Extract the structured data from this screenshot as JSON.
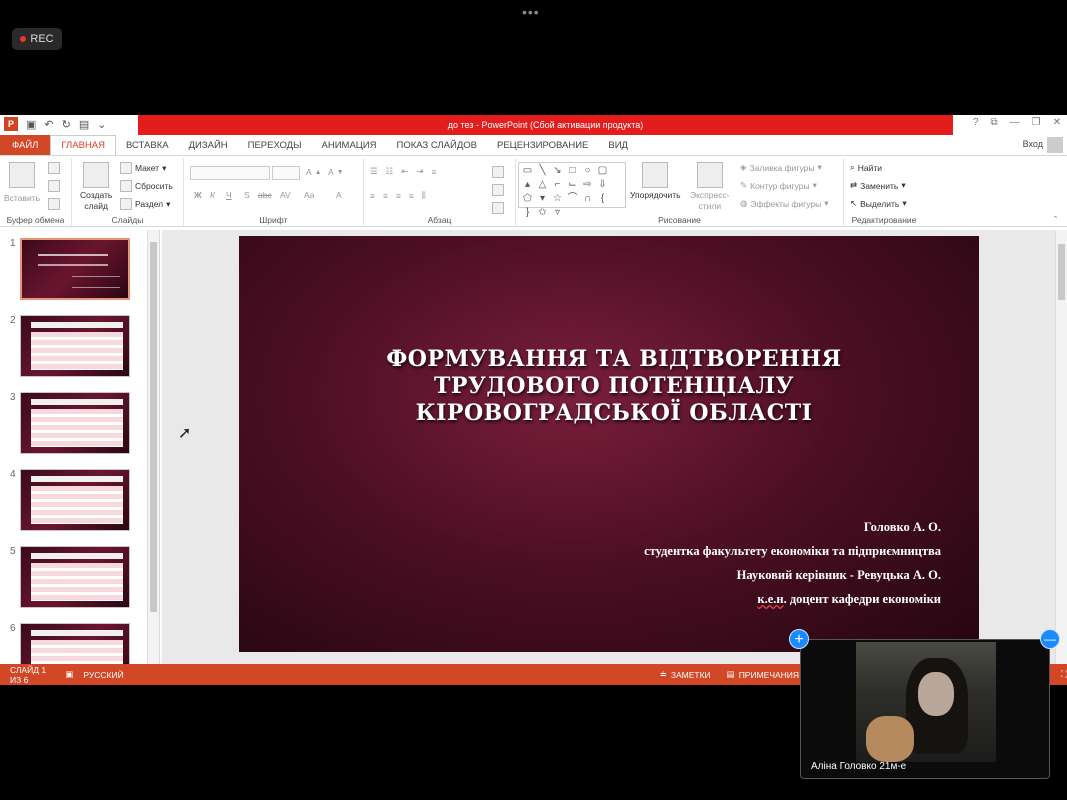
{
  "screen": {
    "dots": "•••",
    "rec_label": "REC"
  },
  "titlebar": {
    "title": "до тез -  PowerPoint (Сбой активации продукта)",
    "logo": "P",
    "controls": [
      "?",
      "⧉",
      "—",
      "❐",
      "✕"
    ]
  },
  "tabs": [
    "ФАЙЛ",
    "ГЛАВНАЯ",
    "ВСТАВКА",
    "ДИЗАЙН",
    "ПЕРЕХОДЫ",
    "АНИМАЦИЯ",
    "ПОКАЗ СЛАЙДОВ",
    "РЕЦЕНЗИРОВАНИЕ",
    "ВИД"
  ],
  "active_tab": "ГЛАВНАЯ",
  "signin": "Вход",
  "ribbon": {
    "clipboard": {
      "paste": "Вставить",
      "label": "Буфер обмена"
    },
    "slides": {
      "new_slide_1": "Создать",
      "new_slide_2": "слайд",
      "layout": "Макет",
      "reset": "Сбросить",
      "section": "Раздел",
      "label": "Слайды"
    },
    "font": {
      "label": "Шрифт",
      "bold": "Ж",
      "italic": "К",
      "underline": "Ч",
      "strike": "S",
      "abc": "abc",
      "spacing": "AV",
      "case": "Aa",
      "color": "A"
    },
    "paragraph": {
      "label": "Абзац"
    },
    "drawing": {
      "arrange_1": "Упорядочить",
      "styles_1": "Экспресс-",
      "styles_2": "стили",
      "fill": "Заливка фигуры",
      "outline": "Контур фигуры",
      "effects": "Эффекты фигуры",
      "label": "Рисование"
    },
    "editing": {
      "find": "Найти",
      "replace": "Заменить",
      "select": "Выделить",
      "label": "Редактирование"
    }
  },
  "thumbnails": [
    {
      "num": "1",
      "kind": "title",
      "selected": true
    },
    {
      "num": "2",
      "kind": "table",
      "selected": false
    },
    {
      "num": "3",
      "kind": "table",
      "selected": false
    },
    {
      "num": "4",
      "kind": "table",
      "selected": false
    },
    {
      "num": "5",
      "kind": "table",
      "selected": false
    },
    {
      "num": "6",
      "kind": "table",
      "selected": false
    }
  ],
  "slide": {
    "title_1": "ФОРМУВАННЯ ТА ВІДТВОРЕННЯ",
    "title_2": "ТРУДОВОГО ПОТЕНЦІАЛУ",
    "title_3": "КІРОВОГРАДСЬКОЇ ОБЛАСТІ",
    "author": "Головко А. О.",
    "student": "студентка факультету економіки та підприємництва",
    "advisor": "Науковий керівник - Ревуцька А. О.",
    "degree_abbr": "к.е.н",
    "degree_rest": ". доцент кафедри економіки"
  },
  "statusbar": {
    "slide_of": "СЛАЙД 1 ИЗ 6",
    "language": "РУССКИЙ",
    "notes": "ЗАМЕТКИ",
    "comments": "ПРИМЕЧАНИЯ"
  },
  "video": {
    "name": "Аліна Головко 21м-е",
    "plus": "+",
    "minus": "—"
  },
  "colors": {
    "accent": "#d24726",
    "title_bar": "#e31c1c",
    "video_button": "#1a8cff"
  }
}
